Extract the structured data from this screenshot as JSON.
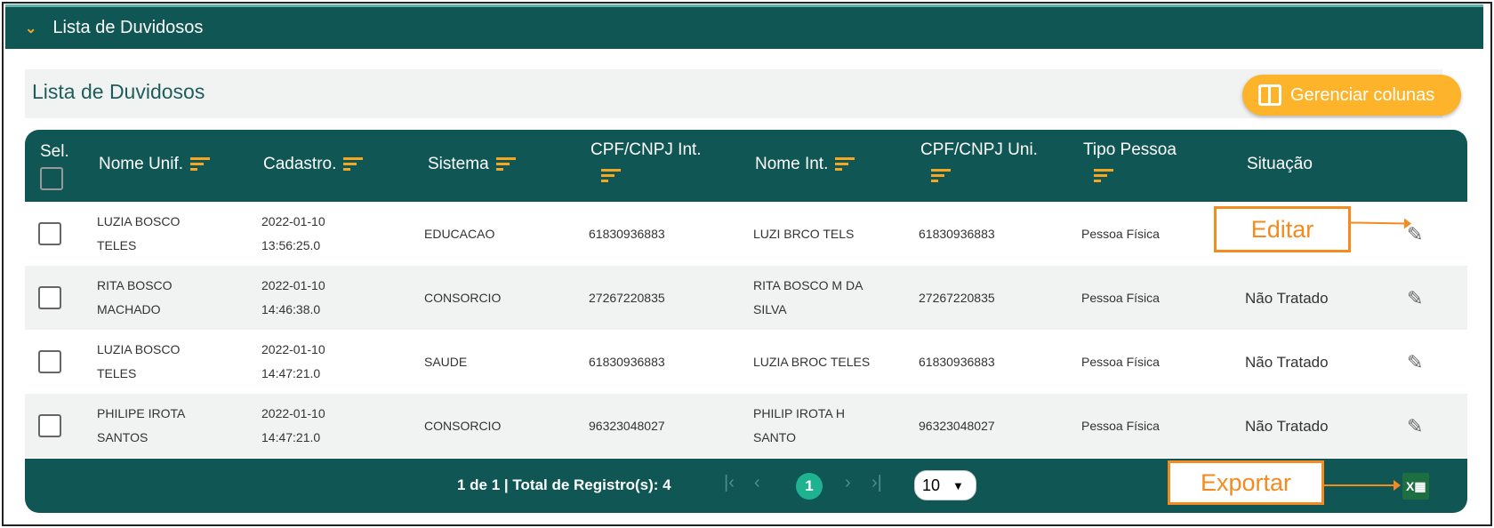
{
  "panel": {
    "title": "Lista de Duvidosos"
  },
  "section": {
    "title": "Lista de Duvidosos",
    "manage_columns": "Gerenciar colunas"
  },
  "columns": [
    "Sel.",
    "Nome Unif.",
    "Cadastro.",
    "Sistema",
    "CPF/CNPJ Int.",
    "Nome Int.",
    "CPF/CNPJ Uni.",
    "Tipo Pessoa",
    "Situação"
  ],
  "rows": [
    {
      "nome_unif": [
        "LUZIA BOSCO",
        "TELES"
      ],
      "cadastro": [
        "2022-01-10",
        "13:56:25.0"
      ],
      "sistema": "EDUCACAO",
      "cpf_int": "61830936883",
      "nome_int": [
        "LUZI BRCO TELS",
        ""
      ],
      "cpf_uni": "61830936883",
      "tipo": "Pessoa Física",
      "situacao": ""
    },
    {
      "nome_unif": [
        "RITA BOSCO",
        "MACHADO"
      ],
      "cadastro": [
        "2022-01-10",
        "14:46:38.0"
      ],
      "sistema": "CONSORCIO",
      "cpf_int": "27267220835",
      "nome_int": [
        "RITA BOSCO M DA",
        "SILVA"
      ],
      "cpf_uni": "27267220835",
      "tipo": "Pessoa Física",
      "situacao": "Não Tratado"
    },
    {
      "nome_unif": [
        "LUZIA BOSCO",
        "TELES"
      ],
      "cadastro": [
        "2022-01-10",
        "14:47:21.0"
      ],
      "sistema": "SAUDE",
      "cpf_int": "61830936883",
      "nome_int": [
        "LUZIA BROC TELES",
        ""
      ],
      "cpf_uni": "61830936883",
      "tipo": "Pessoa Física",
      "situacao": "Não Tratado"
    },
    {
      "nome_unif": [
        "PHILIPE IROTA",
        "SANTOS"
      ],
      "cadastro": [
        "2022-01-10",
        "14:47:21.0"
      ],
      "sistema": "CONSORCIO",
      "cpf_int": "96323048027",
      "nome_int": [
        "PHILIP IROTA H",
        "SANTO"
      ],
      "cpf_uni": "96323048027",
      "tipo": "Pessoa Física",
      "situacao": "Não Tratado"
    }
  ],
  "footer": {
    "summary": "1 de 1 | Total de Registro(s): 4",
    "current_page": "1",
    "page_size": "10"
  },
  "annotations": {
    "edit": "Editar",
    "export": "Exportar"
  },
  "icons": {
    "edit": "pencil-icon",
    "export": "excel-icon",
    "collapse": "chevron-down-icon"
  },
  "colors": {
    "header": "#105654",
    "accent": "#fdb32a",
    "page_active": "#1eb290",
    "annotation": "#f58a1f"
  }
}
